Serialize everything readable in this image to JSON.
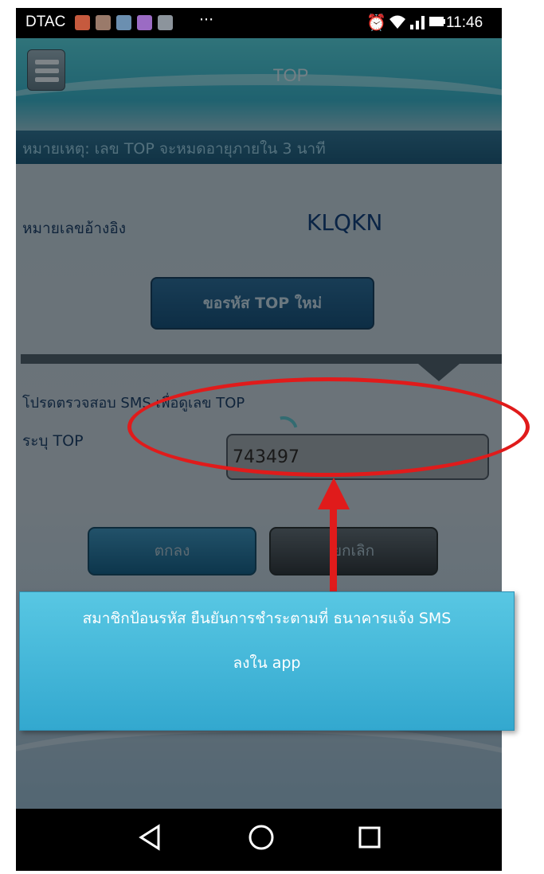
{
  "status_bar": {
    "carrier": "DTAC",
    "more": "···",
    "time": "11:46",
    "icons": [
      "alarm-icon",
      "wifi-icon",
      "signal-icon",
      "battery-icon"
    ]
  },
  "header": {
    "title": "TOP",
    "menu_icon": "menu-icon"
  },
  "notice": "หมายเหตุ: เลข TOP จะหมดอายุภายใน 3 นาที",
  "reference": {
    "label": "หมายเลขอ้างอิง",
    "value": "KLQKN"
  },
  "request_new_top_button": "ขอรหัส TOP ใหม่",
  "sms_hint": "โปรดตรวจสอบ SMS เพื่อดูเลข TOP",
  "top_field": {
    "label": "ระบุ TOP",
    "value": "743497"
  },
  "buttons": {
    "ok": "ตกลง",
    "cancel": "ยกเลิก"
  },
  "nav_bar": [
    "back-icon",
    "home-icon",
    "recents-icon"
  ],
  "annotation": {
    "callout_line1": "สมาชิกป้อนรหัส ยืนยันการชำระตามที่  ธนาคารแจ้ง SMS",
    "callout_line2": "ลงใน app",
    "color": "#e01b1b",
    "callout_color": "#3fb4d9"
  }
}
